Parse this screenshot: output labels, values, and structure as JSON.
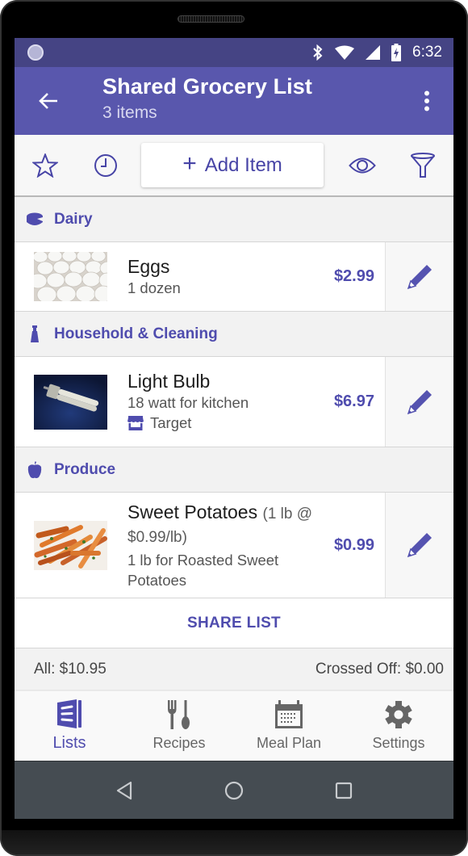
{
  "status_bar": {
    "time": "6:32",
    "icons": [
      "notification-icon",
      "bluetooth-icon",
      "wifi-icon",
      "signal-icon",
      "battery-charging-icon"
    ]
  },
  "app_bar": {
    "title": "Shared Grocery List",
    "subtitle": "3 items",
    "back_icon": "arrow-back-icon",
    "overflow_icon": "more-vert-icon"
  },
  "toolbar": {
    "favorites_icon": "star-icon",
    "history_icon": "clock-icon",
    "add_item_plus": "+",
    "add_item_label": "Add Item",
    "view_icon": "eye-icon",
    "filter_icon": "filter-icon"
  },
  "sections": [
    {
      "label": "Dairy",
      "icon": "cheese-icon",
      "items": [
        {
          "name": "Eggs",
          "qty": "",
          "detail": "1 dozen",
          "store": "",
          "price": "$2.99",
          "thumb": "eggs"
        }
      ]
    },
    {
      "label": "Household & Cleaning",
      "icon": "spray-bottle-icon",
      "items": [
        {
          "name": "Light Bulb",
          "qty": "",
          "detail": "18 watt for kitchen",
          "store": "Target",
          "price": "$6.97",
          "thumb": "bulb"
        }
      ]
    },
    {
      "label": "Produce",
      "icon": "apple-icon",
      "items": [
        {
          "name": "Sweet Potatoes",
          "qty": "(1 lb @ $0.99/lb)",
          "detail": "1 lb for Roasted Sweet Potatoes",
          "store": "",
          "price": "$0.99",
          "thumb": "fries"
        }
      ]
    }
  ],
  "share": {
    "label": "SHARE LIST"
  },
  "totals": {
    "all": "All: $10.95",
    "crossed_off": "Crossed Off: $0.00"
  },
  "bottom_nav": [
    {
      "label": "Lists",
      "icon": "lists-icon",
      "active": true
    },
    {
      "label": "Recipes",
      "icon": "fork-spoon-icon",
      "active": false
    },
    {
      "label": "Meal Plan",
      "icon": "calendar-icon",
      "active": false
    },
    {
      "label": "Settings",
      "icon": "gear-icon",
      "active": false
    }
  ],
  "colors": {
    "status_bar": "#454484",
    "primary": "#5957ad",
    "accent": "#4f4cae",
    "system_nav": "#454c52"
  }
}
